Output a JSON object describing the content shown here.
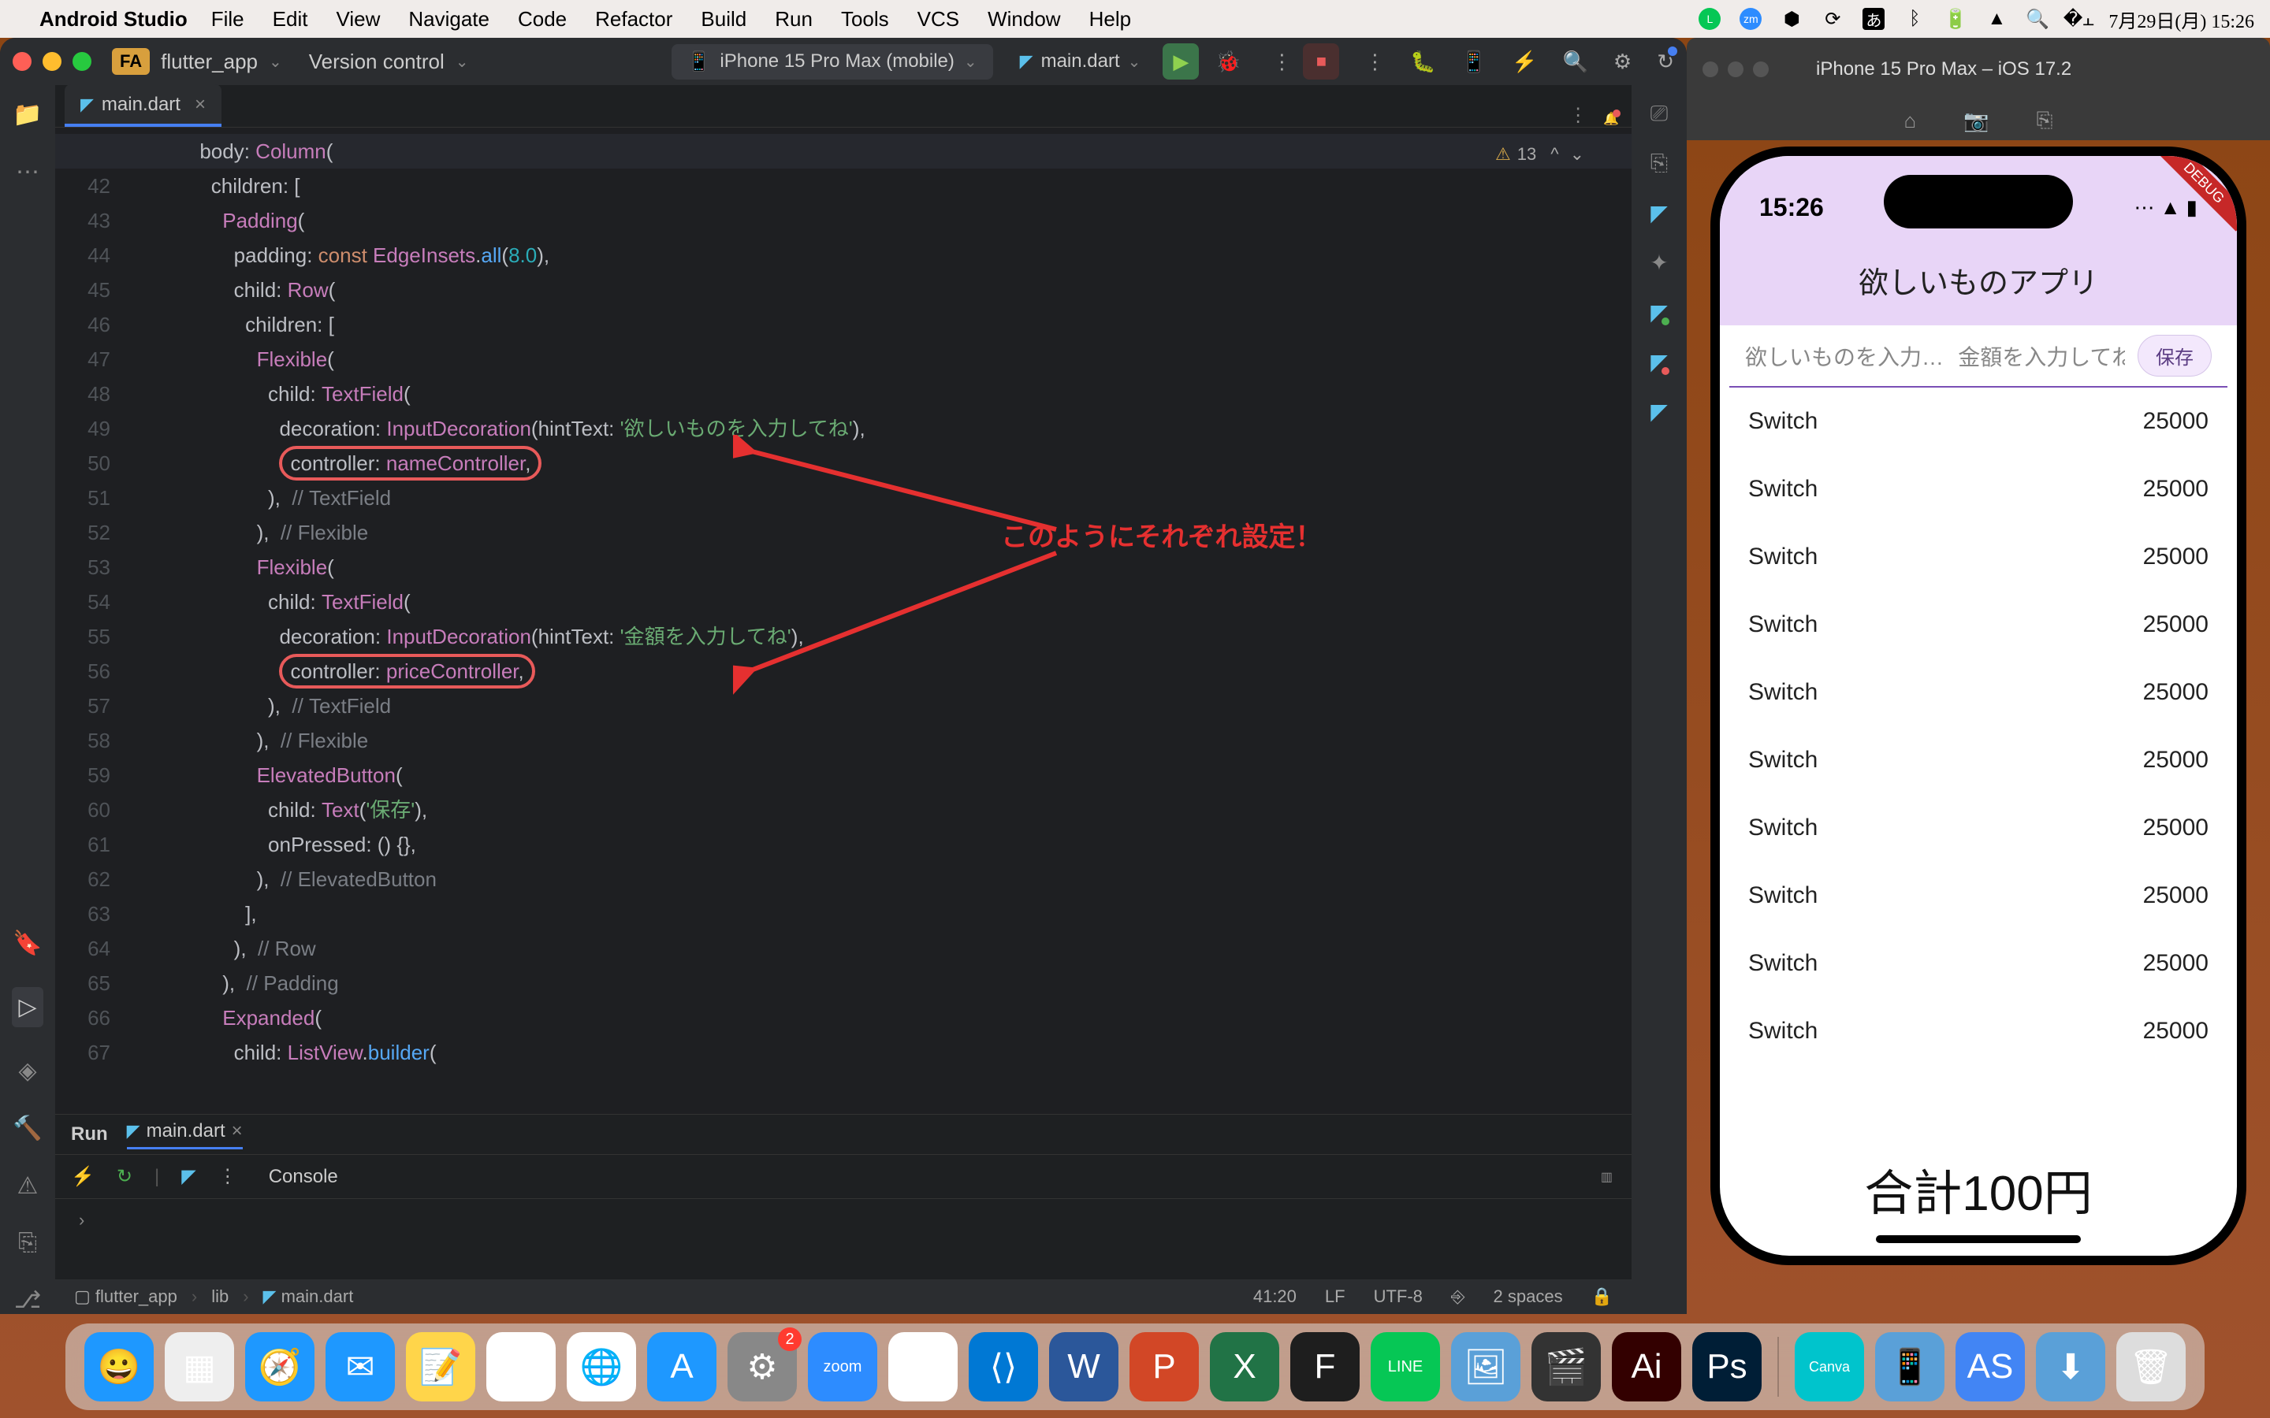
{
  "menubar": {
    "app": "Android Studio",
    "items": [
      "File",
      "Edit",
      "View",
      "Navigate",
      "Code",
      "Refactor",
      "Build",
      "Run",
      "Tools",
      "VCS",
      "Window",
      "Help"
    ],
    "datetime": "7月29日(月)  15:26"
  },
  "ide": {
    "project_chip": "FA",
    "project": "flutter_app",
    "vc": "Version control",
    "device": "iPhone 15 Pro Max (mobile)",
    "run_config": "main.dart",
    "tab_file": "main.dart",
    "warn_count": "13",
    "line_start": 41,
    "lines": [
      {
        "t": "      body: ",
        "tok": [
          [
            "Column",
            "cls"
          ],
          [
            "(",
            "p"
          ]
        ]
      },
      {
        "t": "        children: ["
      },
      {
        "t": "          ",
        "tok": [
          [
            "Padding",
            "cls"
          ],
          [
            "(",
            "p"
          ]
        ]
      },
      {
        "t": "            padding: ",
        "tok": [
          [
            "const ",
            "kw"
          ],
          [
            "EdgeInsets",
            "cls"
          ],
          [
            ".",
            "p"
          ],
          [
            "all",
            "fn"
          ],
          [
            "(",
            "p"
          ],
          [
            "8.0",
            "num"
          ],
          [
            "),",
            "p"
          ]
        ]
      },
      {
        "t": "            child: ",
        "tok": [
          [
            "Row",
            "cls"
          ],
          [
            "(",
            "p"
          ]
        ]
      },
      {
        "t": "              children: ["
      },
      {
        "t": "                ",
        "tok": [
          [
            "Flexible",
            "cls"
          ],
          [
            "(",
            "p"
          ]
        ]
      },
      {
        "t": "                  child: ",
        "tok": [
          [
            "TextField",
            "cls"
          ],
          [
            "(",
            "p"
          ]
        ]
      },
      {
        "t": "                    decoration: ",
        "tok": [
          [
            "InputDecoration",
            "cls"
          ],
          [
            "(hintText: ",
            "p"
          ],
          [
            "'欲しいものを入力してね'",
            "str"
          ],
          [
            "),",
            "p"
          ]
        ]
      },
      {
        "t": "                    ",
        "box": "controller: nameController,"
      },
      {
        "t": "                  ),  ",
        "tok": [
          [
            "// TextField",
            "cmt"
          ]
        ]
      },
      {
        "t": "                ),  ",
        "tok": [
          [
            "// Flexible",
            "cmt"
          ]
        ]
      },
      {
        "t": "                ",
        "tok": [
          [
            "Flexible",
            "cls"
          ],
          [
            "(",
            "p"
          ]
        ]
      },
      {
        "t": "                  child: ",
        "tok": [
          [
            "TextField",
            "cls"
          ],
          [
            "(",
            "p"
          ]
        ]
      },
      {
        "t": "                    decoration: ",
        "tok": [
          [
            "InputDecoration",
            "cls"
          ],
          [
            "(hintText: ",
            "p"
          ],
          [
            "'金額を入力してね'",
            "str"
          ],
          [
            "),",
            "p"
          ]
        ]
      },
      {
        "t": "                    ",
        "box": "controller: priceController,"
      },
      {
        "t": "                  ),  ",
        "tok": [
          [
            "// TextField",
            "cmt"
          ]
        ]
      },
      {
        "t": "                ),  ",
        "tok": [
          [
            "// Flexible",
            "cmt"
          ]
        ]
      },
      {
        "t": "                ",
        "tok": [
          [
            "ElevatedButton",
            "cls"
          ],
          [
            "(",
            "p"
          ]
        ]
      },
      {
        "t": "                  child: ",
        "tok": [
          [
            "Text",
            "cls"
          ],
          [
            "(",
            "p"
          ],
          [
            "'保存'",
            "str"
          ],
          [
            "),",
            "p"
          ]
        ]
      },
      {
        "t": "                  onPressed: () {},"
      },
      {
        "t": "                ),  ",
        "tok": [
          [
            "// ElevatedButton",
            "cmt"
          ]
        ]
      },
      {
        "t": "              ],"
      },
      {
        "t": "            ),  ",
        "tok": [
          [
            "// Row",
            "cmt"
          ]
        ]
      },
      {
        "t": "          ),  ",
        "tok": [
          [
            "// Padding",
            "cmt"
          ]
        ]
      },
      {
        "t": "          ",
        "tok": [
          [
            "Expanded",
            "cls"
          ],
          [
            "(",
            "p"
          ]
        ]
      },
      {
        "t": "            child: ",
        "tok": [
          [
            "ListView",
            "cls"
          ],
          [
            ".",
            "p"
          ],
          [
            "builder",
            "fn"
          ],
          [
            "(",
            "p"
          ]
        ]
      }
    ],
    "annotation": "このようにそれぞれ設定！",
    "run_label": "Run",
    "run_tab": "main.dart",
    "console": "Console",
    "breadcrumb": [
      "flutter_app",
      "lib",
      "main.dart"
    ],
    "status": {
      "pos": "41:20",
      "le": "LF",
      "enc": "UTF-8",
      "indent": "2 spaces"
    }
  },
  "sim": {
    "title": "iPhone 15 Pro Max – iOS 17.2",
    "time": "15:26",
    "app_title": "欲しいものアプリ",
    "hint1": "欲しいものを入力し…",
    "hint2": "金額を入力してね",
    "save": "保存",
    "list": [
      {
        "name": "Switch",
        "price": "25000"
      },
      {
        "name": "Switch",
        "price": "25000"
      },
      {
        "name": "Switch",
        "price": "25000"
      },
      {
        "name": "Switch",
        "price": "25000"
      },
      {
        "name": "Switch",
        "price": "25000"
      },
      {
        "name": "Switch",
        "price": "25000"
      },
      {
        "name": "Switch",
        "price": "25000"
      },
      {
        "name": "Switch",
        "price": "25000"
      },
      {
        "name": "Switch",
        "price": "25000"
      },
      {
        "name": "Switch",
        "price": "25000"
      }
    ],
    "total": "合計100円",
    "debug": "DEBUG"
  },
  "dock": {
    "apps": [
      {
        "name": "finder",
        "bg": "#1e98ff",
        "g": "😀"
      },
      {
        "name": "launchpad",
        "bg": "#eee",
        "g": "▦"
      },
      {
        "name": "safari",
        "bg": "#1e98ff",
        "g": "🧭"
      },
      {
        "name": "mail",
        "bg": "#1e98ff",
        "g": "✉"
      },
      {
        "name": "notes",
        "bg": "#ffd54a",
        "g": "📝"
      },
      {
        "name": "freeform",
        "bg": "#fff",
        "g": "∿"
      },
      {
        "name": "chrome",
        "bg": "#fff",
        "g": "🌐"
      },
      {
        "name": "appstore",
        "bg": "#1e98ff",
        "g": "A"
      },
      {
        "name": "settings",
        "bg": "#888",
        "g": "⚙",
        "badge": "2"
      },
      {
        "name": "zoom",
        "bg": "#2d8cff",
        "g": "zoom"
      },
      {
        "name": "slack",
        "bg": "#fff",
        "g": "⁂"
      },
      {
        "name": "vscode",
        "bg": "#0078d4",
        "g": "⟨⟩"
      },
      {
        "name": "word",
        "bg": "#2b579a",
        "g": "W"
      },
      {
        "name": "powerpoint",
        "bg": "#d24726",
        "g": "P"
      },
      {
        "name": "excel",
        "bg": "#217346",
        "g": "X"
      },
      {
        "name": "figma",
        "bg": "#1e1e1e",
        "g": "F"
      },
      {
        "name": "line",
        "bg": "#06c755",
        "g": "LINE"
      },
      {
        "name": "preview",
        "bg": "#5aa0d8",
        "g": "🖼"
      },
      {
        "name": "finalcut",
        "bg": "#333",
        "g": "🎬"
      },
      {
        "name": "illustrator",
        "bg": "#330000",
        "g": "Ai"
      },
      {
        "name": "photoshop",
        "bg": "#001e36",
        "g": "Ps"
      }
    ],
    "apps_right": [
      {
        "name": "canva",
        "bg": "#00c4cc",
        "g": "Canva"
      },
      {
        "name": "xcode-sim",
        "bg": "#5aa0d8",
        "g": "📱"
      },
      {
        "name": "android-studio",
        "bg": "#4285f4",
        "g": "AS"
      },
      {
        "name": "downloads",
        "bg": "#5aa0d8",
        "g": "⬇"
      },
      {
        "name": "trash",
        "bg": "#ddd",
        "g": "🗑"
      }
    ]
  }
}
